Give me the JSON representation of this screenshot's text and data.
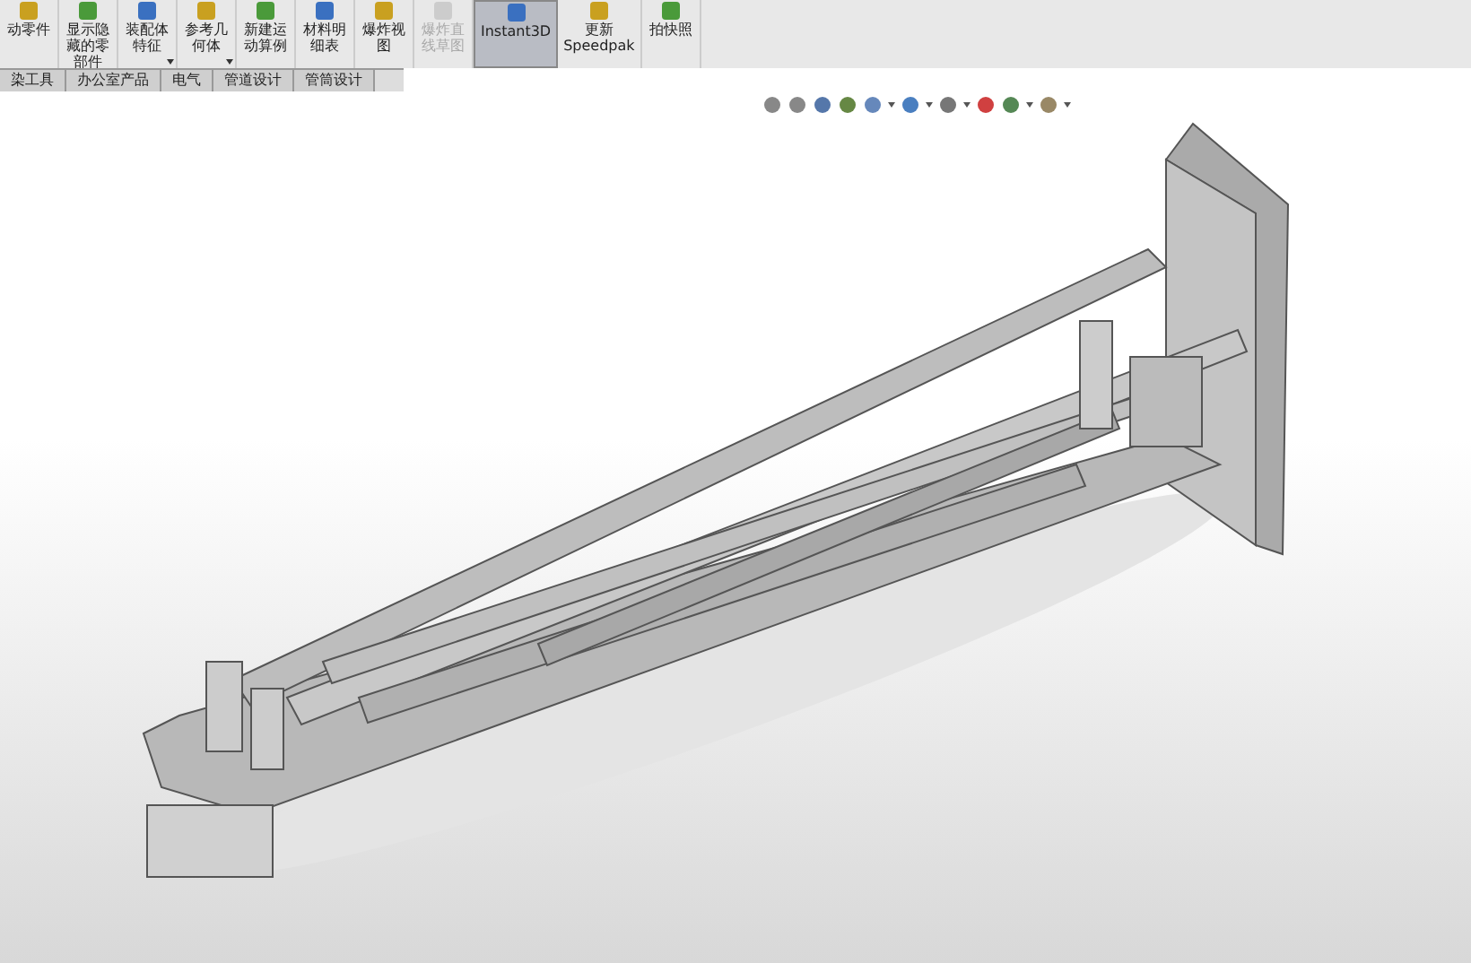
{
  "toolbar": {
    "buttons": [
      {
        "label": "动零件",
        "dropdown": false,
        "disabled": false,
        "selected": false
      },
      {
        "label": "显示隐藏的零部件",
        "dropdown": false,
        "disabled": false,
        "selected": false
      },
      {
        "label": "装配体特征",
        "dropdown": true,
        "disabled": false,
        "selected": false
      },
      {
        "label": "参考几何体",
        "dropdown": true,
        "disabled": false,
        "selected": false
      },
      {
        "label": "新建运动算例",
        "dropdown": false,
        "disabled": false,
        "selected": false
      },
      {
        "label": "材料明细表",
        "dropdown": false,
        "disabled": false,
        "selected": false
      },
      {
        "label": "爆炸视图",
        "dropdown": false,
        "disabled": false,
        "selected": false
      },
      {
        "label": "爆炸直线草图",
        "dropdown": false,
        "disabled": true,
        "selected": false
      },
      {
        "label": "Instant3D",
        "dropdown": false,
        "disabled": false,
        "selected": true
      },
      {
        "label": "更新 Speedpak",
        "dropdown": false,
        "disabled": false,
        "selected": false
      },
      {
        "label": "拍快照",
        "dropdown": false,
        "disabled": false,
        "selected": false
      }
    ]
  },
  "tabs": [
    {
      "label": "染工具",
      "selected": false
    },
    {
      "label": "办公室产品",
      "selected": false
    },
    {
      "label": "电气",
      "selected": false
    },
    {
      "label": "管道设计",
      "selected": false
    },
    {
      "label": "管筒设计",
      "selected": false
    }
  ]
}
